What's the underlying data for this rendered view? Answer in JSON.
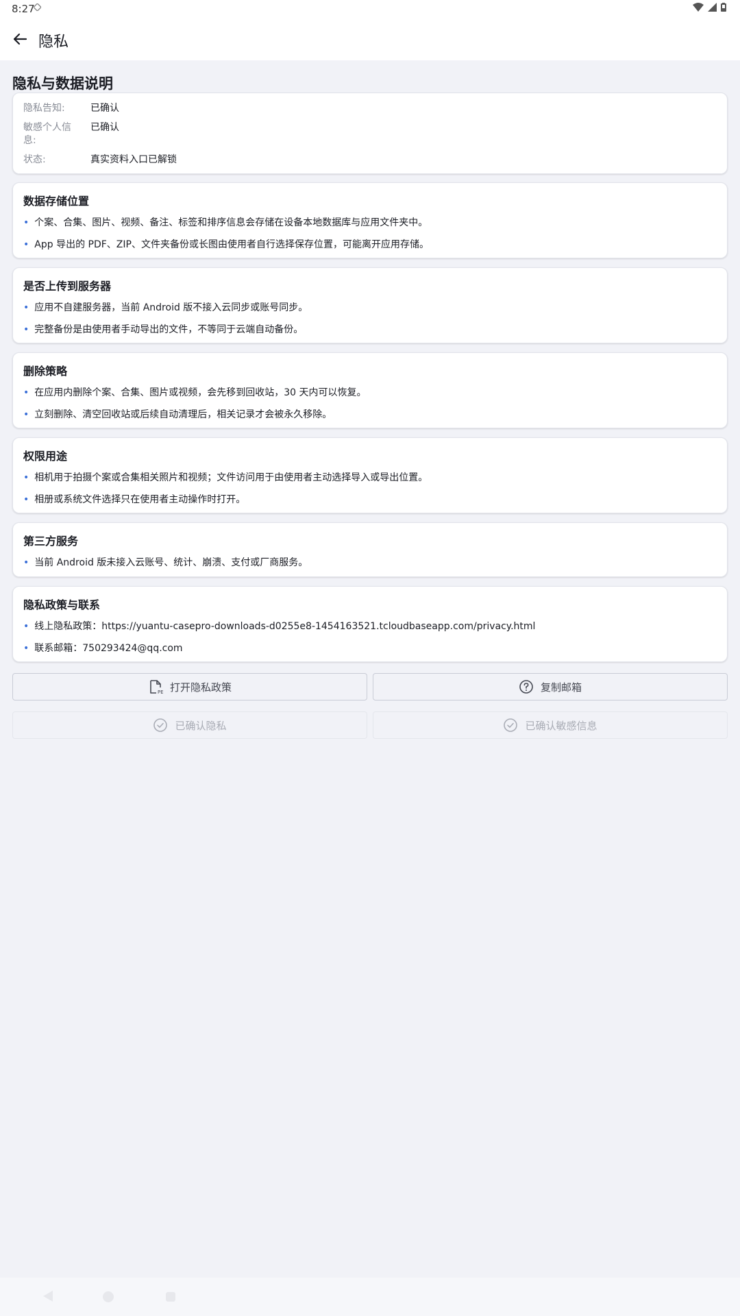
{
  "status_bar": {
    "time": "8:27"
  },
  "app_bar": {
    "title": "隐私"
  },
  "page": {
    "heading": "隐私与数据说明"
  },
  "summary": {
    "rows": [
      {
        "label": "隐私告知:",
        "value": "已确认"
      },
      {
        "label": "敏感个人信息:",
        "value": "已确认"
      },
      {
        "label": "状态:",
        "value": "真实资料入口已解锁"
      }
    ]
  },
  "sections": [
    {
      "title": "数据存储位置",
      "bullets": [
        "个案、合集、图片、视频、备注、标签和排序信息会存储在设备本地数据库与应用文件夹中。",
        "App 导出的 PDF、ZIP、文件夹备份或长图由使用者自行选择保存位置，可能离开应用存储。"
      ]
    },
    {
      "title": "是否上传到服务器",
      "bullets": [
        "应用不自建服务器，当前 Android 版不接入云同步或账号同步。",
        "完整备份是由使用者手动导出的文件，不等同于云端自动备份。"
      ]
    },
    {
      "title": "删除策略",
      "bullets": [
        "在应用内删除个案、合集、图片或视频，会先移到回收站，30 天内可以恢复。",
        "立刻删除、清空回收站或后续自动清理后，相关记录才会被永久移除。"
      ]
    },
    {
      "title": "权限用途",
      "bullets": [
        "相机用于拍摄个案或合集相关照片和视频；文件访问用于由使用者主动选择导入或导出位置。",
        "相册或系统文件选择只在使用者主动操作时打开。"
      ]
    },
    {
      "title": "第三方服务",
      "bullets": [
        "当前 Android 版未接入云账号、统计、崩溃、支付或厂商服务。"
      ]
    },
    {
      "title": "隐私政策与联系",
      "bullets": [
        "线上隐私政策：https://yuantu-casepro-downloads-d0255e8-1454163521.tcloudbaseapp.com/privacy.html",
        "联系邮箱：750293424@qq.com"
      ]
    }
  ],
  "buttons": {
    "open_policy": "打开隐私政策",
    "copy_email": "复制邮箱",
    "confirmed_privacy": "已确认隐私",
    "confirmed_sensitive": "已确认敏感信息"
  },
  "colors": {
    "accent": "#3a6fd8",
    "background": "#f1f2f7"
  }
}
